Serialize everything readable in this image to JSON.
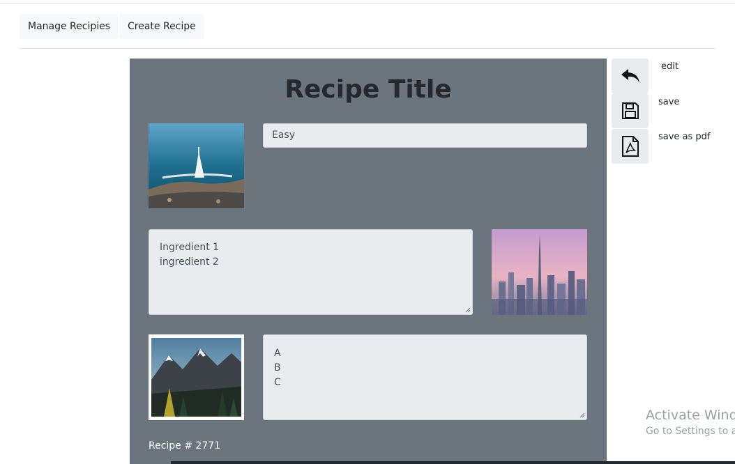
{
  "nav": {
    "manage_label": "Manage Recipies",
    "create_label": "Create Recipe"
  },
  "recipe": {
    "title": "Recipe Title",
    "difficulty": "Easy",
    "ingredients": [
      "Ingredient 1",
      "ingredient 2"
    ],
    "steps": [
      "A",
      "B",
      "C"
    ],
    "number": "Recipe # 2771",
    "images": [
      "dubai-burj-al-arab-photo",
      "dubai-skyline-photo",
      "mountain-forest-photo"
    ]
  },
  "actions": {
    "edit_label": "edit",
    "save_label": "save",
    "pdf_label": "save as pdf",
    "icons": [
      "undo-arrow-icon",
      "floppy-disk-icon",
      "pdf-file-icon"
    ]
  },
  "windows": {
    "activate_text": "Activate Windo",
    "settings_text": "Go to Settings to ac"
  },
  "colors": {
    "card_bg": "#6c757d",
    "field_bg": "#e9ecef",
    "button_bg": "#f8f9fa"
  }
}
